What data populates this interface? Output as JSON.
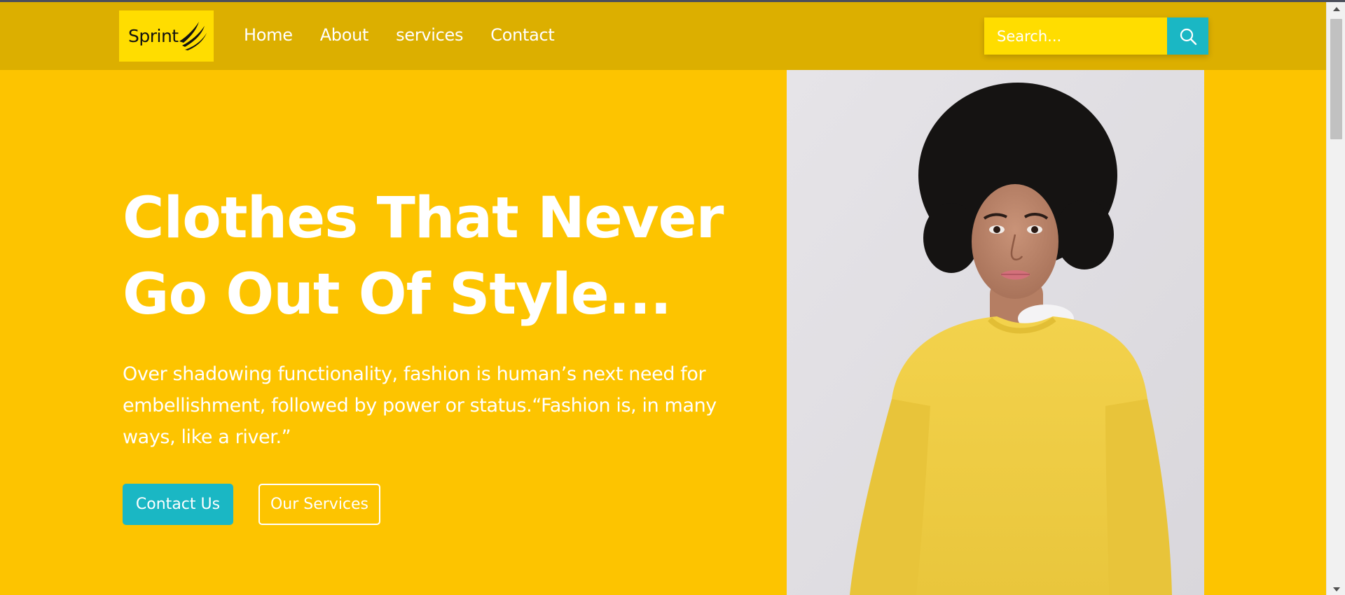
{
  "brand": {
    "logo_text": "Sprint",
    "logo_icon": "sprint-swoosh-icon"
  },
  "nav": {
    "items": [
      {
        "label": "Home"
      },
      {
        "label": "About"
      },
      {
        "label": "services"
      },
      {
        "label": "Contact"
      }
    ]
  },
  "search": {
    "placeholder": "Search...",
    "icon": "search-icon"
  },
  "hero": {
    "title_line1": "Clothes That Never",
    "title_line2": "Go Out Of Style...",
    "description": "Over shadowing functionality, fashion is human’s next need for embellishment, followed by power or status.“Fashion is, in many ways, like a river.”",
    "primary_button": "Contact Us",
    "secondary_button": "Our Services"
  },
  "colors": {
    "background": "#fdc400",
    "header": "#dcaf00",
    "search_field": "#ffdd00",
    "accent": "#1ab7c4",
    "text": "#ffffff"
  }
}
